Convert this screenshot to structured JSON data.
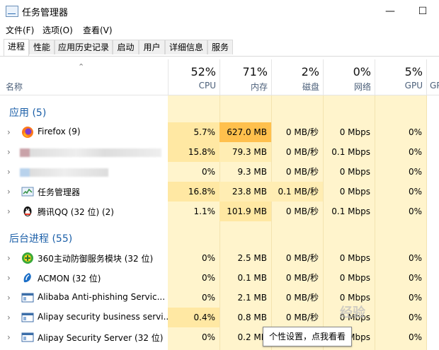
{
  "window": {
    "title": "任务管理器"
  },
  "menu": [
    "文件(F)",
    "选项(O)",
    "查看(V)"
  ],
  "tabs": [
    "进程",
    "性能",
    "应用历史记录",
    "启动",
    "用户",
    "详细信息",
    "服务"
  ],
  "header": {
    "name_label": "名称",
    "columns": [
      {
        "pct": "52%",
        "label": "CPU"
      },
      {
        "pct": "71%",
        "label": "内存"
      },
      {
        "pct": "2%",
        "label": "磁盘"
      },
      {
        "pct": "0%",
        "label": "网络"
      },
      {
        "pct": "5%",
        "label": "GPU"
      },
      {
        "pct": "",
        "label": "GP"
      }
    ]
  },
  "sections": {
    "apps": "应用 (5)",
    "background": "后台进程 (55)"
  },
  "apps": [
    {
      "name": "Firefox (9)",
      "cpu": "5.7%",
      "mem": "627.0 MB",
      "disk": "0 MB/秒",
      "net": "0 Mbps",
      "gpu": "0%",
      "icon": "firefox-icon"
    },
    {
      "name": "",
      "cpu": "15.8%",
      "mem": "79.3 MB",
      "disk": "0 MB/秒",
      "net": "0.1 Mbps",
      "gpu": "0%",
      "icon": "blurred"
    },
    {
      "name": "",
      "cpu": "0%",
      "mem": "9.3 MB",
      "disk": "0 MB/秒",
      "net": "0 Mbps",
      "gpu": "0%",
      "icon": "blurred"
    },
    {
      "name": "任务管理器",
      "cpu": "16.8%",
      "mem": "23.8 MB",
      "disk": "0.1 MB/秒",
      "net": "0 Mbps",
      "gpu": "0%",
      "icon": "task-manager-icon"
    },
    {
      "name": "腾讯QQ (32 位) (2)",
      "cpu": "1.1%",
      "mem": "101.9 MB",
      "disk": "0 MB/秒",
      "net": "0.1 Mbps",
      "gpu": "0%",
      "icon": "qq-icon"
    }
  ],
  "background": [
    {
      "name": "360主动防御服务模块 (32 位)",
      "cpu": "0%",
      "mem": "2.5 MB",
      "disk": "0 MB/秒",
      "net": "0 Mbps",
      "gpu": "0%",
      "icon": "360-icon"
    },
    {
      "name": "ACMON (32 位)",
      "cpu": "0%",
      "mem": "0.1 MB",
      "disk": "0 MB/秒",
      "net": "0 Mbps",
      "gpu": "0%",
      "icon": "acmon-icon"
    },
    {
      "name": "Alibaba Anti-phishing Servic...",
      "cpu": "0%",
      "mem": "2.1 MB",
      "disk": "0 MB/秒",
      "net": "0 Mbps",
      "gpu": "0%",
      "icon": "service-icon"
    },
    {
      "name": "Alipay security business servi...",
      "cpu": "0.4%",
      "mem": "0.8 MB",
      "disk": "0 MB/秒",
      "net": "0 Mbps",
      "gpu": "0%",
      "icon": "service-icon"
    },
    {
      "name": "Alipay Security Server (32 位)",
      "cpu": "0%",
      "mem": "0.2 MB",
      "disk": "",
      "net": "0 Mbps",
      "gpu": "0%",
      "icon": "service-icon"
    }
  ],
  "tooltip": "个性设置，点我看看",
  "watermark": "经验"
}
